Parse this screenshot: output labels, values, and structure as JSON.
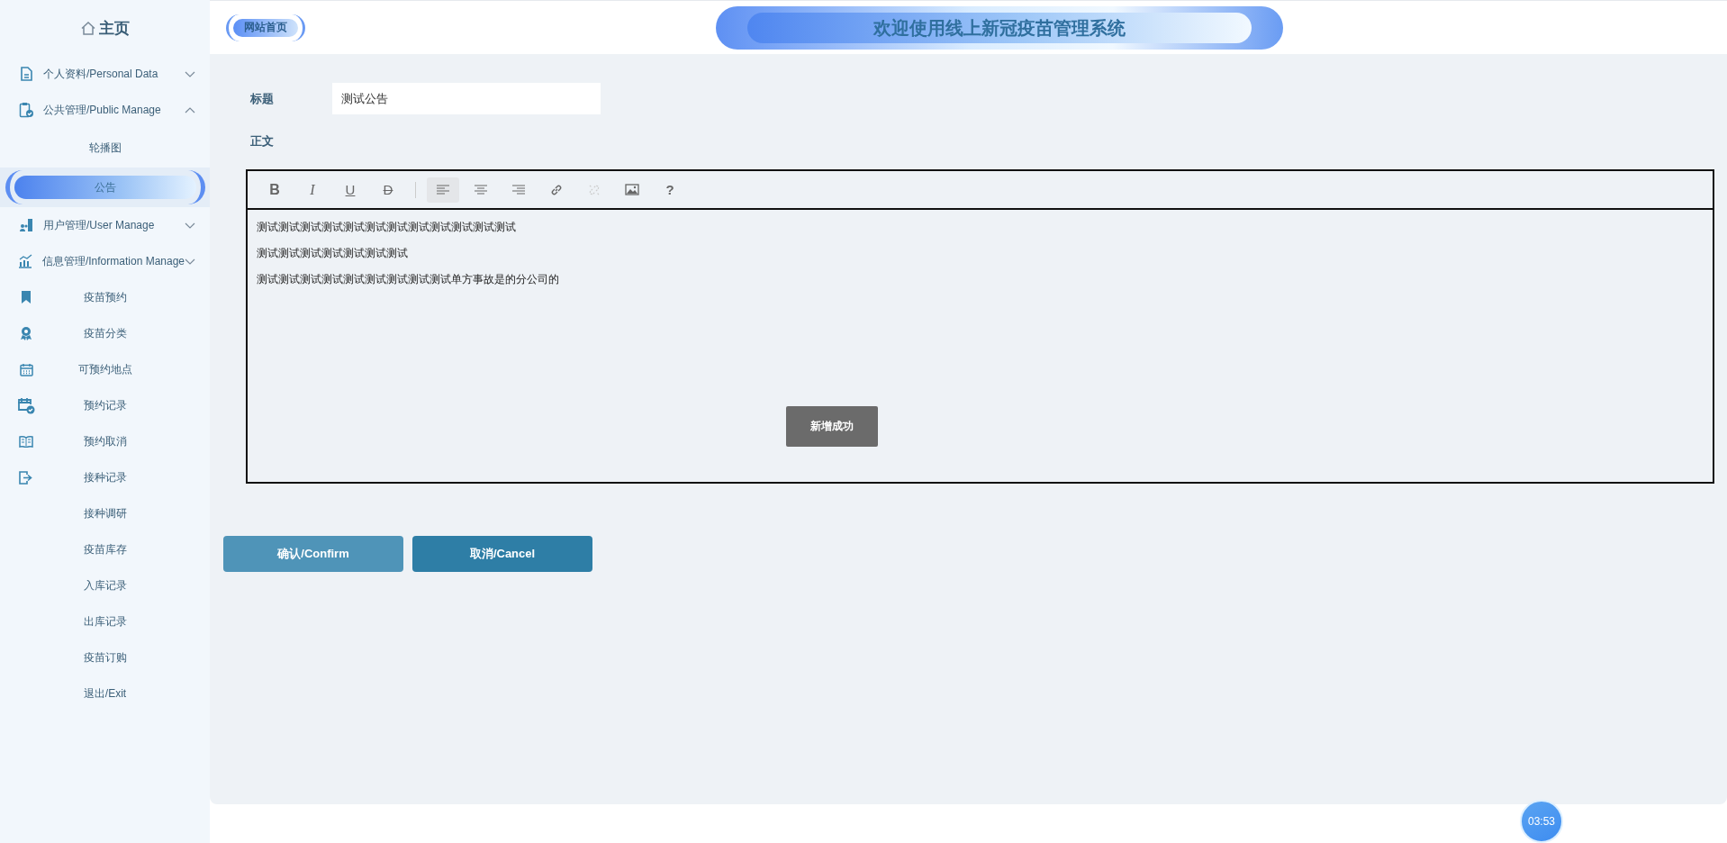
{
  "sidebar": {
    "home": {
      "label": "主页"
    },
    "items": [
      {
        "kind": "group",
        "label": "个人资料/Personal Data",
        "expanded": false
      },
      {
        "kind": "group",
        "label": "公共管理/Public Manage",
        "expanded": true,
        "children": [
          {
            "label": "轮播图",
            "selected": false
          },
          {
            "label": "公告",
            "selected": true
          }
        ]
      },
      {
        "kind": "group",
        "label": "用户管理/User Manage",
        "expanded": false
      },
      {
        "kind": "group",
        "label": "信息管理/Information Manage",
        "expanded": false
      },
      {
        "kind": "link",
        "label": "疫苗预约",
        "selected": false
      },
      {
        "kind": "link",
        "label": "疫苗分类",
        "selected": false
      },
      {
        "kind": "link",
        "label": "可预约地点",
        "selected": false
      },
      {
        "kind": "link",
        "label": "预约记录",
        "selected": false
      },
      {
        "kind": "link",
        "label": "预约取消",
        "selected": false
      },
      {
        "kind": "link",
        "label": "接种记录",
        "selected": false
      },
      {
        "kind": "link",
        "label": "接种调研",
        "selected": false
      },
      {
        "kind": "link",
        "label": "疫苗库存",
        "selected": false
      },
      {
        "kind": "link",
        "label": "入库记录",
        "selected": false
      },
      {
        "kind": "link",
        "label": "出库记录",
        "selected": false
      },
      {
        "kind": "link",
        "label": "疫苗订购",
        "selected": false
      },
      {
        "kind": "link",
        "label": "退出/Exit",
        "selected": false
      }
    ]
  },
  "header": {
    "site_home": "网站首页",
    "banner_title": "欢迎使用线上新冠疫苗管理系统"
  },
  "form": {
    "title_label": "标题",
    "title_value": "测试公告",
    "body_label": "正文",
    "toolbar": [
      {
        "kind": "bold",
        "label": "B",
        "selected": false,
        "disabled": false
      },
      {
        "kind": "italic",
        "label": "I",
        "selected": false,
        "disabled": false
      },
      {
        "kind": "underline",
        "label": "U",
        "selected": false,
        "disabled": false
      },
      {
        "kind": "strike",
        "label": "D",
        "selected": false,
        "disabled": false
      },
      {
        "kind": "separator"
      },
      {
        "kind": "align-left",
        "selected": true,
        "disabled": false
      },
      {
        "kind": "align-center",
        "selected": false,
        "disabled": false
      },
      {
        "kind": "align-right",
        "selected": false,
        "disabled": false
      },
      {
        "kind": "link",
        "selected": false,
        "disabled": false
      },
      {
        "kind": "unlink",
        "selected": false,
        "disabled": true
      },
      {
        "kind": "image",
        "selected": false,
        "disabled": false
      },
      {
        "kind": "help",
        "label": "?",
        "selected": false,
        "disabled": false
      }
    ],
    "body_lines": [
      "测试测试测试测试测试测试测试测试测试测试测试测试",
      "测试测试测试测试测试测试测试",
      "测试测试测试测试测试测试测试测试测试单方事故是的分公司的"
    ],
    "toast": "新增成功",
    "buttons": [
      {
        "label": "确认/Confirm",
        "hovered": true
      },
      {
        "label": "取消/Cancel",
        "hovered": false
      }
    ]
  },
  "timer": "03:53"
}
